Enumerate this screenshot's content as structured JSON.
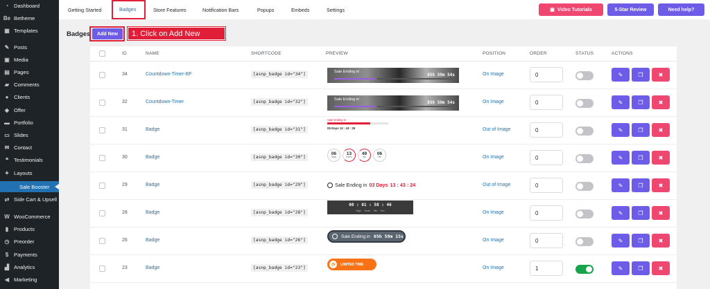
{
  "sidebar": {
    "items": [
      {
        "icon": "dashboard-icon",
        "glyph": "◔",
        "label": "Dashboard"
      },
      {
        "icon": "betheme-icon",
        "glyph": "Be",
        "label": "Betheme"
      },
      {
        "icon": "templates-icon",
        "glyph": "▦",
        "label": "Templates"
      },
      {
        "icon": "posts-icon",
        "glyph": "✎",
        "label": "Posts"
      },
      {
        "icon": "media-icon",
        "glyph": "▣",
        "label": "Media"
      },
      {
        "icon": "pages-icon",
        "glyph": "▤",
        "label": "Pages"
      },
      {
        "icon": "comments-icon",
        "glyph": "▰",
        "label": "Comments"
      },
      {
        "icon": "clients-icon",
        "glyph": "●",
        "label": "Clients"
      },
      {
        "icon": "offer-icon",
        "glyph": "◆",
        "label": "Offer"
      },
      {
        "icon": "portfolio-icon",
        "glyph": "▬",
        "label": "Portfolio"
      },
      {
        "icon": "slides-icon",
        "glyph": "▭",
        "label": "Slides"
      },
      {
        "icon": "contact-icon",
        "glyph": "✉",
        "label": "Contact"
      },
      {
        "icon": "testimonials-icon",
        "glyph": "❝",
        "label": "Testimonials"
      },
      {
        "icon": "layouts-icon",
        "glyph": "✦",
        "label": "Layouts"
      },
      {
        "icon": "sale-booster-icon",
        "glyph": "•",
        "label": "Sale Booster"
      },
      {
        "icon": "side-cart-icon",
        "glyph": "⇄",
        "label": "Side Cart & Upsell"
      },
      {
        "icon": "woocommerce-icon",
        "glyph": "W",
        "label": "WooCommerce"
      },
      {
        "icon": "products-icon",
        "glyph": "▮",
        "label": "Products"
      },
      {
        "icon": "preorder-icon",
        "glyph": "◷",
        "label": "Preorder"
      },
      {
        "icon": "payments-icon",
        "glyph": "$",
        "label": "Payments"
      },
      {
        "icon": "analytics-icon",
        "glyph": "▟",
        "label": "Analytics"
      },
      {
        "icon": "marketing-icon",
        "glyph": "◀",
        "label": "Marketing"
      }
    ]
  },
  "tabs": [
    "Getting Started",
    "Badges",
    "Store Features",
    "Notification Bars",
    "Popups",
    "Embeds",
    "Settings"
  ],
  "top_buttons": {
    "video": "Video Tutorials",
    "review": "5-Star Review",
    "help": "Need help?"
  },
  "page": {
    "title": "Badges",
    "add_new": "Add New",
    "callout": "1. Click on Add New"
  },
  "table": {
    "headers": {
      "id": "ID",
      "name": "NAME",
      "shortcode": "SHORTCODE",
      "preview": "PREVIEW",
      "position": "POSITION",
      "order": "ORDER",
      "status": "STATUS",
      "actions": "ACTIONS"
    },
    "rows": [
      {
        "id": "34",
        "name": "Countdown-Timer-BF",
        "shortcode": "[asnp_badge id=\"34\"]",
        "position": "On Image",
        "order": "0",
        "status": false
      },
      {
        "id": "32",
        "name": "Countdown-Timer",
        "shortcode": "[asnp_badge id=\"32\"]",
        "position": "On Image",
        "order": "0",
        "status": false
      },
      {
        "id": "31",
        "name": "Badge",
        "shortcode": "[asnp_badge id=\"31\"]",
        "position": "Out of Image",
        "order": "0",
        "status": false
      },
      {
        "id": "30",
        "name": "Badge",
        "shortcode": "[asnp_badge id=\"30\"]",
        "position": "On Image",
        "order": "0",
        "status": false
      },
      {
        "id": "29",
        "name": "Badge",
        "shortcode": "[asnp_badge id=\"29\"]",
        "position": "Out of Image",
        "order": "0",
        "status": false
      },
      {
        "id": "28",
        "name": "Badge",
        "shortcode": "[asnp_badge id=\"28\"]",
        "position": "On Image",
        "order": "0",
        "status": false
      },
      {
        "id": "26",
        "name": "Badge",
        "shortcode": "[asnp_badge id=\"26\"]",
        "position": "On Image",
        "order": "0",
        "status": false
      },
      {
        "id": "23",
        "name": "Badge",
        "shortcode": "[asnp_badge id=\"23\"]",
        "position": "On Image",
        "order": "1",
        "status": true
      }
    ]
  },
  "previews": {
    "r34": {
      "label": "Sale Ending in",
      "time": "05h 59m 54s",
      "progress": 0.33
    },
    "r32": {
      "label": "Sale Ending in",
      "time": "05h 59m 54s",
      "progress": 0.33
    },
    "r31": {
      "label": "Sale Ending in",
      "progress": 0.7,
      "time": "05 Days  13 : 43 : 35"
    },
    "r30": [
      {
        "n": "06",
        "u": "Days"
      },
      {
        "n": "13",
        "u": "Hours"
      },
      {
        "n": "49",
        "u": "Min"
      },
      {
        "n": "06",
        "u": "Sec"
      }
    ],
    "r29": {
      "label": "Sale Ending in",
      "days": "03 Days",
      "time": "13 : 43 : 24"
    },
    "r28": {
      "time": "00 : 01 : 58 : 46",
      "units": "Days Hours Min Sec"
    },
    "r26": {
      "label": "Sale Ending in",
      "time": "05h 59m 15s"
    },
    "r23": {
      "label": "LIMITED TIME"
    }
  },
  "colors": {
    "accent": "#6c5ce7",
    "danger": "#ef476f",
    "link": "#2271b1",
    "annotation": "#e01e37",
    "toggle_on": "#16a34a"
  }
}
